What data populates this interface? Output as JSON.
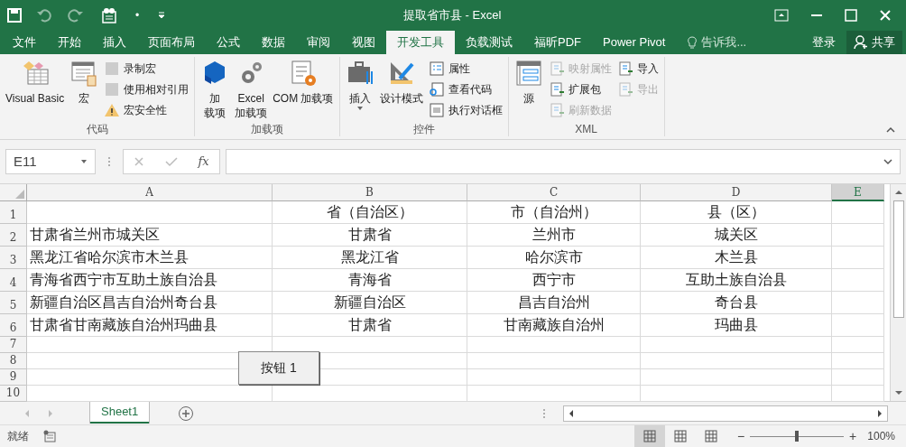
{
  "window": {
    "title": "提取省市县 - Excel"
  },
  "quick_access": {
    "more": "•"
  },
  "ribbon_tabs": [
    {
      "label": "文件",
      "selected": false
    },
    {
      "label": "开始",
      "selected": false
    },
    {
      "label": "插入",
      "selected": false
    },
    {
      "label": "页面布局",
      "selected": false
    },
    {
      "label": "公式",
      "selected": false
    },
    {
      "label": "数据",
      "selected": false
    },
    {
      "label": "审阅",
      "selected": false
    },
    {
      "label": "视图",
      "selected": false
    },
    {
      "label": "开发工具",
      "selected": true
    },
    {
      "label": "负载测试",
      "selected": false
    },
    {
      "label": "福昕PDF",
      "selected": false
    },
    {
      "label": "Power Pivot",
      "selected": false
    }
  ],
  "tell_me": {
    "placeholder": "告诉我..."
  },
  "account": {
    "sign_in": "登录",
    "share": "共享"
  },
  "ribbon_groups": [
    {
      "title": "代码",
      "columns": [
        {
          "kind": "large",
          "lines": [
            "Visual Basic"
          ]
        },
        {
          "kind": "large",
          "lines": [
            "宏"
          ]
        },
        {
          "kind": "stack",
          "items": [
            {
              "label": "录制宏",
              "disabled": false
            },
            {
              "label": "使用相对引用",
              "disabled": false
            },
            {
              "label": "宏安全性",
              "disabled": false
            }
          ]
        }
      ]
    },
    {
      "title": "加载项",
      "columns": [
        {
          "kind": "large",
          "lines": [
            "加",
            "载项"
          ]
        },
        {
          "kind": "large",
          "lines": [
            "Excel",
            "加载项"
          ]
        },
        {
          "kind": "large",
          "lines": [
            "COM 加载项"
          ]
        }
      ]
    },
    {
      "title": "控件",
      "columns": [
        {
          "kind": "large",
          "lines": [
            "插入"
          ],
          "dropdown": true
        },
        {
          "kind": "large",
          "lines": [
            "设计模式"
          ]
        },
        {
          "kind": "stack",
          "items": [
            {
              "label": "属性",
              "disabled": false
            },
            {
              "label": "查看代码",
              "disabled": false
            },
            {
              "label": "执行对话框",
              "disabled": false
            }
          ]
        }
      ]
    },
    {
      "title": "XML",
      "columns": [
        {
          "kind": "large",
          "lines": [
            "源"
          ]
        },
        {
          "kind": "stack",
          "items": [
            {
              "label": "映射属性",
              "disabled": true
            },
            {
              "label": "扩展包",
              "disabled": false
            },
            {
              "label": "刷新数据",
              "disabled": true
            }
          ]
        },
        {
          "kind": "stack",
          "items": [
            {
              "label": "导入",
              "disabled": false
            },
            {
              "label": "导出",
              "disabled": true
            }
          ]
        }
      ]
    }
  ],
  "formula_bar": {
    "name_box": "E11",
    "fx": "fx"
  },
  "sheet": {
    "columns": [
      {
        "label": "A",
        "selected": false
      },
      {
        "label": "B",
        "selected": false
      },
      {
        "label": "C",
        "selected": false
      },
      {
        "label": "D",
        "selected": false
      },
      {
        "label": "E",
        "selected": true
      }
    ],
    "rows": [
      {
        "number": "1",
        "cells": [
          "",
          "省（自治区）",
          "市（自治州）",
          "县（区）",
          ""
        ]
      },
      {
        "number": "2",
        "cells": [
          "甘肃省兰州市城关区",
          "甘肃省",
          "兰州市",
          "城关区",
          ""
        ]
      },
      {
        "number": "3",
        "cells": [
          "黑龙江省哈尔滨市木兰县",
          "黑龙江省",
          "哈尔滨市",
          "木兰县",
          ""
        ]
      },
      {
        "number": "4",
        "cells": [
          "青海省西宁市互助土族自治县",
          "青海省",
          "西宁市",
          "互助土族自治县",
          ""
        ]
      },
      {
        "number": "5",
        "cells": [
          "新疆自治区昌吉自治州奇台县",
          "新疆自治区",
          "昌吉自治州",
          "奇台县",
          ""
        ]
      },
      {
        "number": "6",
        "cells": [
          "甘肃省甘南藏族自治州玛曲县",
          "甘肃省",
          "甘南藏族自治州",
          "玛曲县",
          ""
        ]
      },
      {
        "number": "7",
        "cells": [
          "",
          "",
          "",
          "",
          ""
        ]
      },
      {
        "number": "8",
        "cells": [
          "",
          "",
          "",
          "",
          ""
        ]
      },
      {
        "number": "9",
        "cells": [
          "",
          "",
          "",
          "",
          ""
        ]
      },
      {
        "number": "10",
        "cells": [
          "",
          "",
          "",
          "",
          ""
        ]
      }
    ],
    "form_button": "按钮 1"
  },
  "sheet_tabs": [
    {
      "label": "Sheet1",
      "selected": true
    }
  ],
  "status_bar": {
    "status": "就绪",
    "views": [
      {
        "selected": true
      },
      {
        "selected": false
      },
      {
        "selected": false
      }
    ],
    "zoom": {
      "level": 0.5,
      "minus": "−",
      "plus": "+"
    },
    "zoom_text": "100%"
  }
}
